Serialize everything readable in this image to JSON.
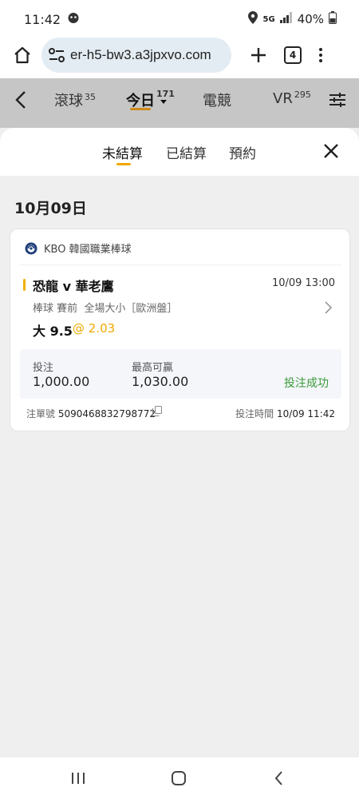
{
  "status_bar": {
    "time": "11:42",
    "network": "5G",
    "battery": "40%"
  },
  "browser": {
    "url": "er-h5-bw3.a3jpxvo.com",
    "tab_count": "4"
  },
  "app_header": {
    "tabs": [
      {
        "label": "滾球",
        "count": "35"
      },
      {
        "label": "今日",
        "count": "171"
      },
      {
        "label": "電競",
        "count": ""
      },
      {
        "label": "VR",
        "count": "295"
      }
    ],
    "active_tab": "今日"
  },
  "sheet": {
    "tabs": [
      "未結算",
      "已結算",
      "預約"
    ],
    "active_tab": "未結算"
  },
  "date_title": "10月09日",
  "bet": {
    "league": "KBO 韓國職業棒球",
    "match": "恐龍 v 華老鷹",
    "match_time": "10/09 13:00",
    "market": "棒球 賽前  全場大小［歐洲盤］",
    "pick": "大 9.5",
    "odds": "@ 2.03",
    "stake_label": "投注",
    "stake_value": "1,000.00",
    "max_win_label": "最高可贏",
    "max_win_value": "1,030.00",
    "status": "投注成功",
    "order_label": "注單號",
    "order_no": "5090468832798772",
    "bet_time_label": "投注時間",
    "bet_time": "10/09 11:42"
  },
  "colors": {
    "accent": "#f0a800",
    "success": "#3a9a3a",
    "brand_underline": "#d08a1a"
  }
}
